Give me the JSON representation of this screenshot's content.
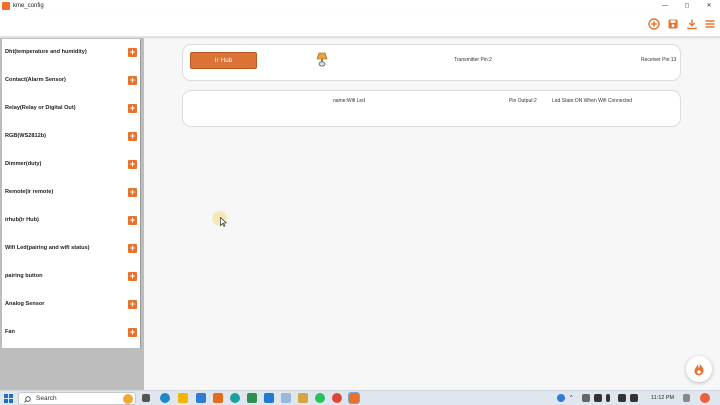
{
  "window": {
    "title": "kme_config"
  },
  "window_controls": {
    "minimize": "—",
    "maximize": "◻",
    "close": "✕"
  },
  "colors": {
    "accent": "#e8722c",
    "button": "#dd7236"
  },
  "toolbar": {
    "icons": [
      "add-circle-icon",
      "save-icon",
      "download-icon",
      "menu-icon"
    ]
  },
  "sidebar": {
    "items": [
      {
        "label": "Dht(temperature and humidity)"
      },
      {
        "label": "Contact(Alarm Sensor)"
      },
      {
        "label": "Relay(Relay or Digital Out)"
      },
      {
        "label": "RGB(WS2812b)"
      },
      {
        "label": "Dimmer(duty)"
      },
      {
        "label": "Remote(ir remote)"
      },
      {
        "label": "irhub(ir Hub)"
      },
      {
        "label": "Wifi Led(pairing and wifi status)"
      },
      {
        "label": "pairing button"
      },
      {
        "label": "Analog Sensor"
      },
      {
        "label": "Fan"
      }
    ],
    "add_label": "+"
  },
  "cards": {
    "irhub": {
      "button_label": "Ir Hub",
      "transmitter": "Transmitter Pin:2",
      "receiver": "Receiver Pin:13"
    },
    "wifiled": {
      "name": "name:Wifi Led",
      "pin_output": "Pin Output:2",
      "led_state": "Led State:ON When Wifi Connected"
    }
  },
  "taskbar": {
    "search_label": "Search",
    "time": "11:12 PM"
  }
}
